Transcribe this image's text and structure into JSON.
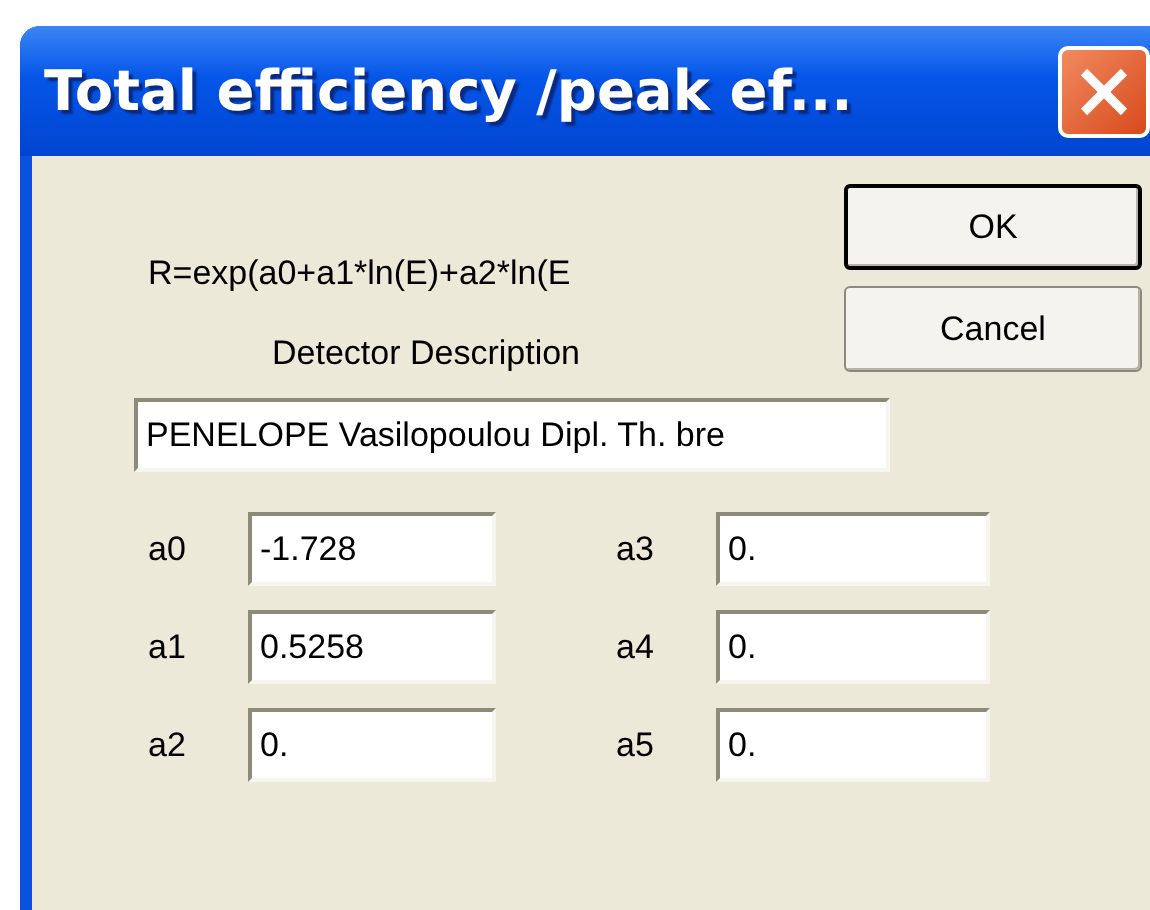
{
  "window": {
    "title": "Total efficiency /peak ef..."
  },
  "formula": "R=exp(a0+a1*ln(E)+a2*ln(E",
  "buttons": [
    {
      "label": "OK",
      "default": true
    },
    {
      "label": "Cancel",
      "default": false
    }
  ],
  "description": {
    "label": "Detector Description",
    "value": "PENELOPE Vasilopoulou Dipl. Th. bre"
  },
  "coefficient_columns": [
    {
      "coefficients": [
        {
          "label": "a0",
          "value": "-1.728"
        },
        {
          "label": "a1",
          "value": "0.5258"
        },
        {
          "label": "a2",
          "value": "0."
        }
      ]
    },
    {
      "coefficients": [
        {
          "label": "a3",
          "value": "0."
        },
        {
          "label": "a4",
          "value": "0."
        },
        {
          "label": "a5",
          "value": "0."
        }
      ]
    }
  ]
}
